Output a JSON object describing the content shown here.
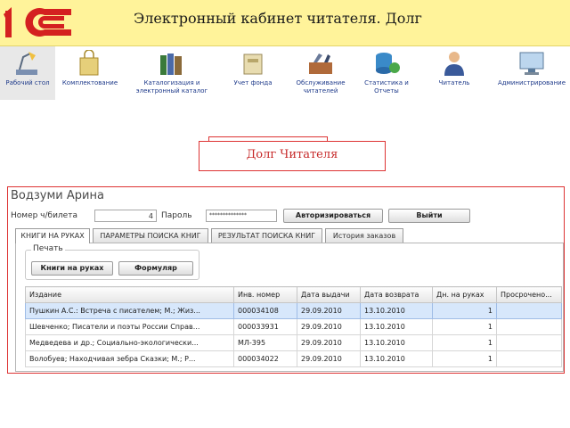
{
  "header": {
    "logo_text": "1С",
    "title": "Электронный кабинет читателя. Долг"
  },
  "toolbar": [
    {
      "label": "Рабочий стол",
      "icon": "desk-lamp-icon"
    },
    {
      "label": "Комплектование",
      "icon": "shopping-bag-icon"
    },
    {
      "label": "Каталогизация и электронный каталог",
      "icon": "books-icon"
    },
    {
      "label": "Учет фонда",
      "icon": "box-icon"
    },
    {
      "label": "Обслуживание читателей",
      "icon": "toolbox-icon"
    },
    {
      "label": "Статистика и Отчеты",
      "icon": "database-icon"
    },
    {
      "label": "Читатель",
      "icon": "person-icon"
    },
    {
      "label": "Администрирование",
      "icon": "monitor-icon"
    }
  ],
  "debt_heading": "Долг Читателя",
  "reader": {
    "name": "Водзуми Арина",
    "card_label": "Номер ч/билета",
    "card_value": "4",
    "password_label": "Пароль",
    "password_value": "**************",
    "authorize_label": "Авторизироваться",
    "exit_label": "Выйти"
  },
  "tabs": [
    "КНИГИ НА РУКАХ",
    "ПАРАМЕТРЫ ПОИСКА КНИГ",
    "РЕЗУЛЬТАТ ПОИСКА КНИГ",
    "История заказов"
  ],
  "print_group": {
    "title": "Печать",
    "books_button": "Книги на руках",
    "form_button": "Формуляр"
  },
  "table": {
    "columns": [
      "Издание",
      "Инв. номер",
      "Дата выдачи",
      "Дата возврата",
      "Дн. на руках",
      "Просрочено..."
    ],
    "rows": [
      [
        "Пушкин А.С.: Встреча с писателем; М.; Жиз...",
        "000034108",
        "29.09.2010",
        "13.10.2010",
        "1",
        ""
      ],
      [
        "Шевченко; Писатели и поэты России Справ...",
        "000033931",
        "29.09.2010",
        "13.10.2010",
        "1",
        ""
      ],
      [
        "Медведева и др.; Социально-экологически...",
        "МЛ-395",
        "29.09.2010",
        "13.10.2010",
        "1",
        ""
      ],
      [
        "Волобуев; Находчивая зебра Сказки; М.; Р...",
        "000034022",
        "29.09.2010",
        "13.10.2010",
        "1",
        ""
      ]
    ]
  },
  "colors": {
    "header_bg": "#fff39a",
    "logo_red": "#d42020",
    "accent_red": "#c62828",
    "selected_row": "#d7e7fb"
  }
}
